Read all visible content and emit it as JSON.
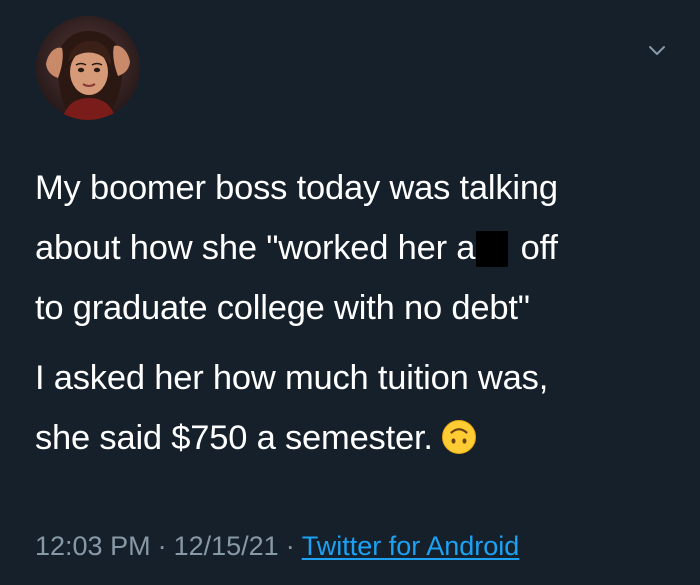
{
  "author": {
    "avatar_icon": "profile-avatar"
  },
  "menu": {
    "icon": "chevron-down-icon"
  },
  "tweet": {
    "paragraph1": {
      "line1": "My boomer boss today was talking",
      "line2_before": "about how she \"worked her a",
      "line2_after": " off",
      "line3": "to graduate college with no debt\""
    },
    "paragraph2": {
      "line1": "I asked her how much tuition was,",
      "line2": "she said $750 a semester.",
      "emoji_icon": "upside-down-face-emoji"
    }
  },
  "meta": {
    "time": "12:03 PM",
    "separator": "·",
    "date": "12/15/21",
    "source": "Twitter for Android"
  },
  "colors": {
    "background": "#15202b",
    "text": "#ffffff",
    "meta_text": "#8899a6",
    "link": "#1da1f2",
    "redaction": "#000000"
  }
}
